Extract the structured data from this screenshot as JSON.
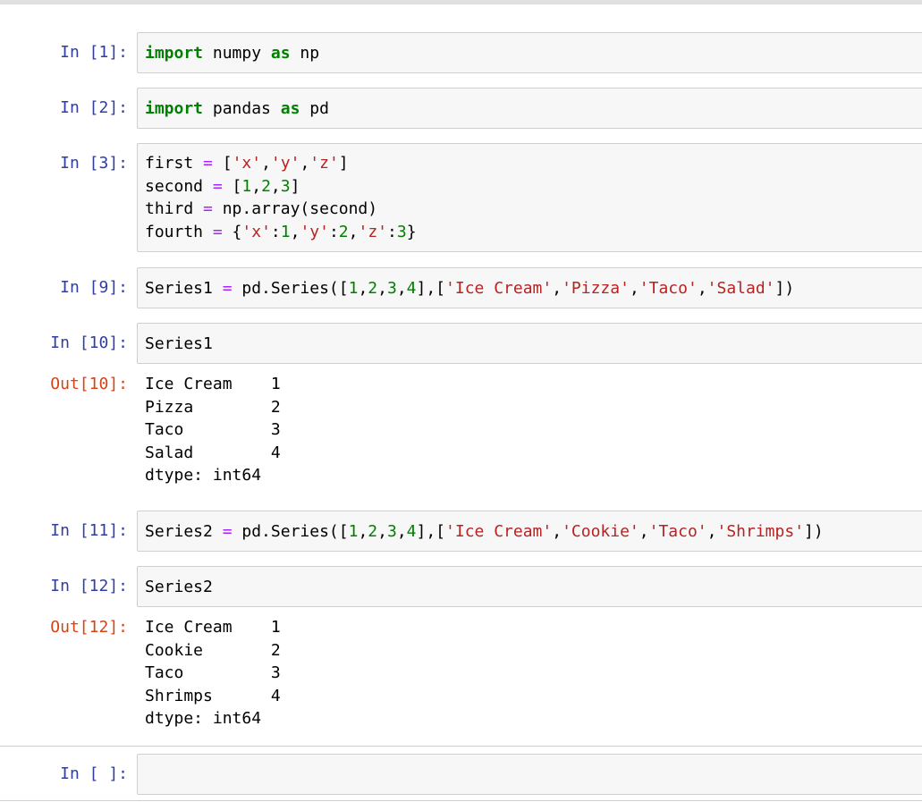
{
  "cells": [
    {
      "prompt": "In [1]:",
      "lines": [
        [
          [
            "kw",
            "import"
          ],
          [
            "t",
            " numpy "
          ],
          [
            "kw",
            "as"
          ],
          [
            "t",
            " np"
          ]
        ]
      ]
    },
    {
      "prompt": "In [2]:",
      "lines": [
        [
          [
            "kw",
            "import"
          ],
          [
            "t",
            " pandas "
          ],
          [
            "kw",
            "as"
          ],
          [
            "t",
            " pd"
          ]
        ]
      ]
    },
    {
      "prompt": "In [3]:",
      "lines": [
        [
          [
            "t",
            "first "
          ],
          [
            "op",
            "="
          ],
          [
            "t",
            " ["
          ],
          [
            "str",
            "'x'"
          ],
          [
            "t",
            ","
          ],
          [
            "str",
            "'y'"
          ],
          [
            "t",
            ","
          ],
          [
            "str",
            "'z'"
          ],
          [
            "t",
            "]"
          ]
        ],
        [
          [
            "t",
            "second "
          ],
          [
            "op",
            "="
          ],
          [
            "t",
            " ["
          ],
          [
            "num",
            "1"
          ],
          [
            "t",
            ","
          ],
          [
            "num",
            "2"
          ],
          [
            "t",
            ","
          ],
          [
            "num",
            "3"
          ],
          [
            "t",
            "]"
          ]
        ],
        [
          [
            "t",
            "third "
          ],
          [
            "op",
            "="
          ],
          [
            "t",
            " np.array(second)"
          ]
        ],
        [
          [
            "t",
            "fourth "
          ],
          [
            "op",
            "="
          ],
          [
            "t",
            " {"
          ],
          [
            "str",
            "'x'"
          ],
          [
            "t",
            ":"
          ],
          [
            "num",
            "1"
          ],
          [
            "t",
            ","
          ],
          [
            "str",
            "'y'"
          ],
          [
            "t",
            ":"
          ],
          [
            "num",
            "2"
          ],
          [
            "t",
            ","
          ],
          [
            "str",
            "'z'"
          ],
          [
            "t",
            ":"
          ],
          [
            "num",
            "3"
          ],
          [
            "t",
            "}"
          ]
        ]
      ]
    },
    {
      "prompt": "In [9]:",
      "lines": [
        [
          [
            "t",
            "Series1 "
          ],
          [
            "op",
            "="
          ],
          [
            "t",
            " pd.Series(["
          ],
          [
            "num",
            "1"
          ],
          [
            "t",
            ","
          ],
          [
            "num",
            "2"
          ],
          [
            "t",
            ","
          ],
          [
            "num",
            "3"
          ],
          [
            "t",
            ","
          ],
          [
            "num",
            "4"
          ],
          [
            "t",
            "],["
          ],
          [
            "str",
            "'Ice Cream'"
          ],
          [
            "t",
            ","
          ],
          [
            "str",
            "'Pizza'"
          ],
          [
            "t",
            ","
          ],
          [
            "str",
            "'Taco'"
          ],
          [
            "t",
            ","
          ],
          [
            "str",
            "'Salad'"
          ],
          [
            "t",
            "])"
          ]
        ]
      ]
    },
    {
      "prompt": "In [10]:",
      "lines": [
        [
          [
            "t",
            "Series1"
          ]
        ]
      ]
    },
    {
      "prompt": "In [11]:",
      "lines": [
        [
          [
            "t",
            "Series2 "
          ],
          [
            "op",
            "="
          ],
          [
            "t",
            " pd.Series(["
          ],
          [
            "num",
            "1"
          ],
          [
            "t",
            ","
          ],
          [
            "num",
            "2"
          ],
          [
            "t",
            ","
          ],
          [
            "num",
            "3"
          ],
          [
            "t",
            ","
          ],
          [
            "num",
            "4"
          ],
          [
            "t",
            "],["
          ],
          [
            "str",
            "'Ice Cream'"
          ],
          [
            "t",
            ","
          ],
          [
            "str",
            "'Cookie'"
          ],
          [
            "t",
            ","
          ],
          [
            "str",
            "'Taco'"
          ],
          [
            "t",
            ","
          ],
          [
            "str",
            "'Shrimps'"
          ],
          [
            "t",
            "])"
          ]
        ]
      ]
    },
    {
      "prompt": "In [12]:",
      "lines": [
        [
          [
            "t",
            "Series2"
          ]
        ]
      ]
    },
    {
      "prompt": "In [ ]:",
      "lines": [
        [
          [
            "t",
            ""
          ]
        ]
      ]
    }
  ],
  "outputs": [
    {
      "prompt": "Out[10]:",
      "text": "Ice Cream    1\nPizza        2\nTaco         3\nSalad        4\ndtype: int64"
    },
    {
      "prompt": "Out[12]:",
      "text": "Ice Cream    1\nCookie       2\nTaco         3\nShrimps      4\ndtype: int64"
    }
  ]
}
